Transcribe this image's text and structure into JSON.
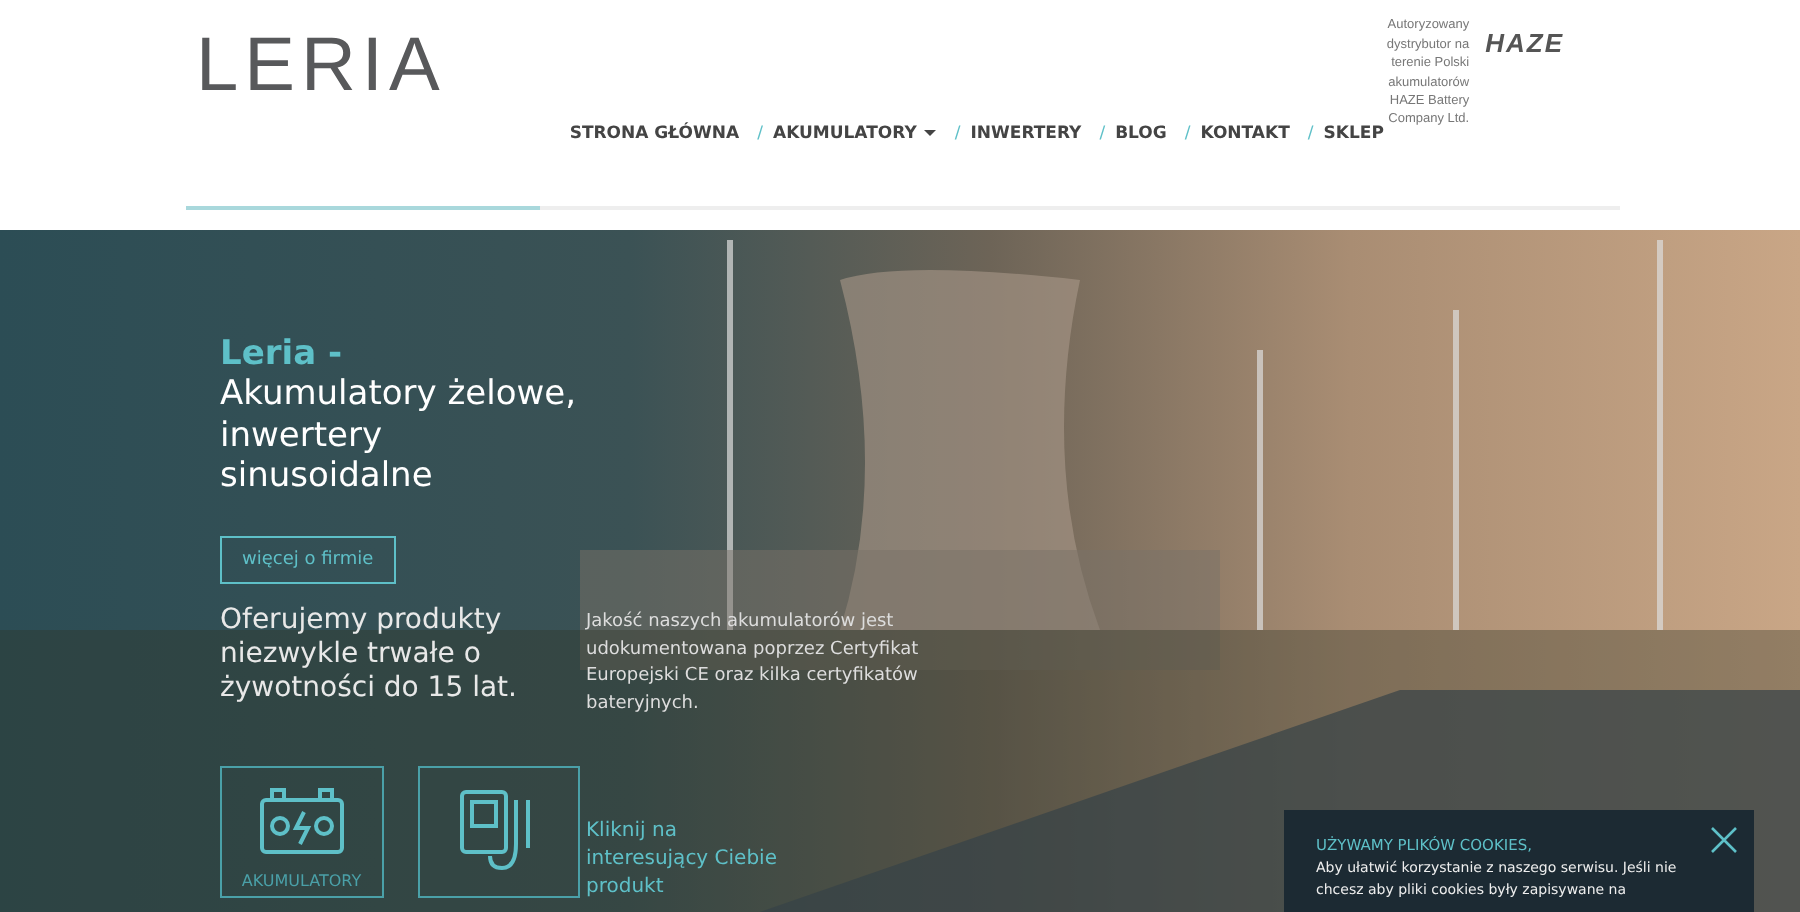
{
  "header": {
    "logo": "LERIA",
    "nav": [
      {
        "label": "STRONA GŁÓWNA",
        "dropdown": false
      },
      {
        "separator": "/",
        "label": "AKUMULATORY",
        "dropdown": true
      },
      {
        "separator": "/",
        "label": "INWERTERY",
        "dropdown": false
      },
      {
        "separator": "/",
        "label": "BLOG",
        "dropdown": false
      },
      {
        "separator": "/",
        "label": "KONTAKT",
        "dropdown": false
      },
      {
        "separator": "/",
        "label": "SKLEP",
        "dropdown": false
      }
    ],
    "distributor": "Autoryzowany dystrybutor na terenie Polski akumulatorów HAZE Battery Company Ltd.",
    "partner_logo": "HAZE"
  },
  "hero": {
    "brand": "Leria -",
    "headline": "Akumulatory żelowe, inwertery sinusoidalne",
    "button": "więcej o firmie",
    "tagline": "Oferujemy produkty niezwykle trwałe o żywotności do 15 lat.",
    "quality": "Jakość naszych akumulatorów jest udokumentowana poprzez Certyfikat Europejski CE oraz kilka certyfikatów bateryjnych.",
    "tiles": [
      {
        "kind": "battery",
        "label": "AKUMULATORY"
      },
      {
        "kind": "inverter"
      }
    ],
    "prompt": "Kliknij na interesujący Ciebie produkt"
  },
  "cookie": {
    "title": "UŻYWAMY PLIKÓW COOKIES,",
    "text": "Aby ułatwić korzystanie z naszego serwisu. Jeśli nie chcesz aby pliki cookies były zapisywane na"
  }
}
